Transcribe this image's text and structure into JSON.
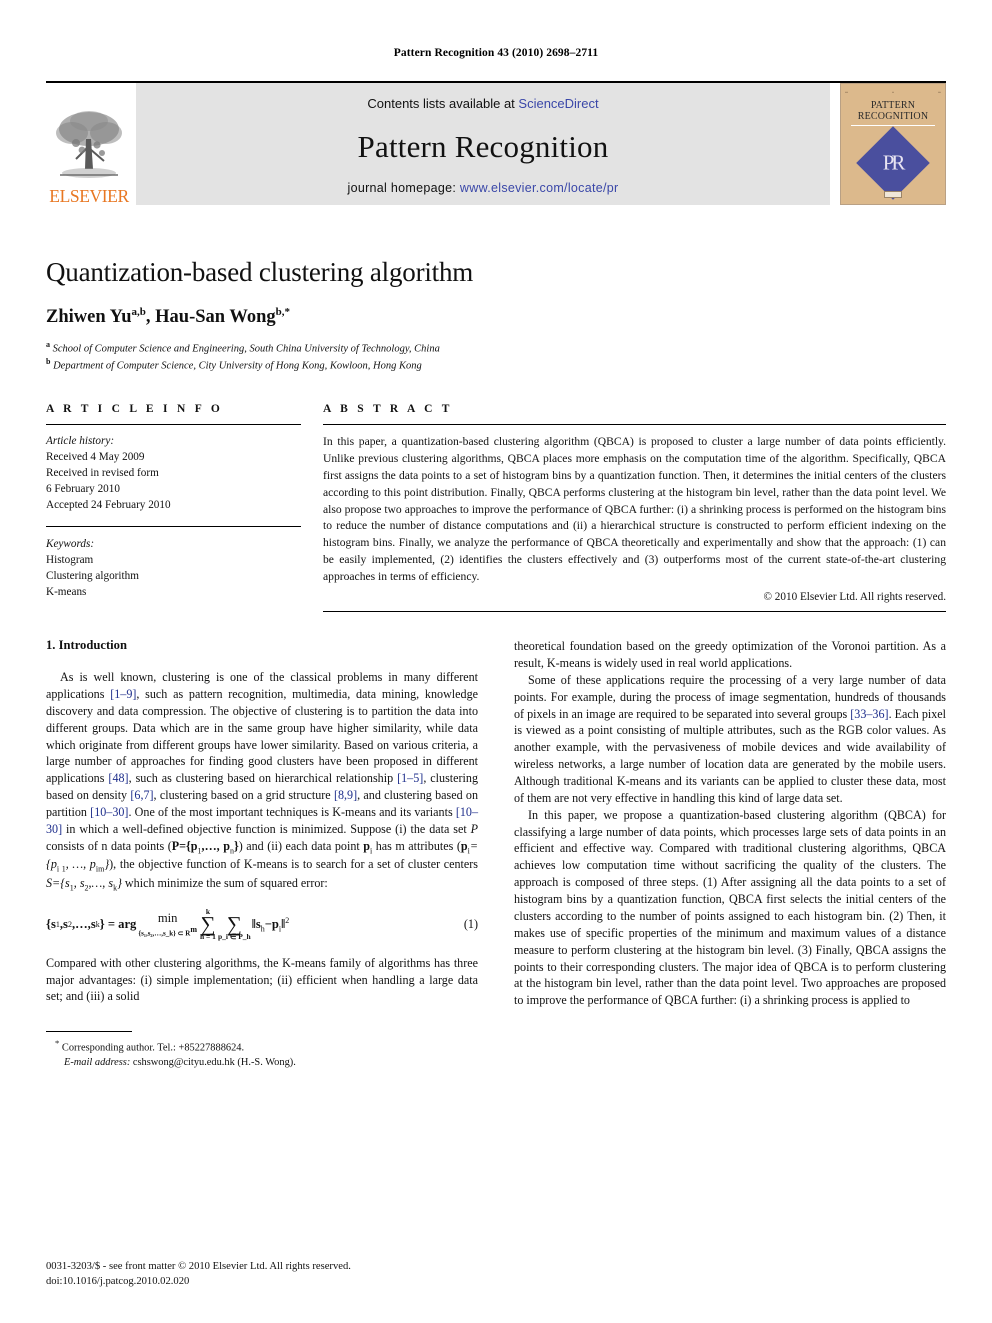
{
  "running_head": "Pattern Recognition 43 (2010) 2698–2711",
  "banner": {
    "publisher_wordmark": "ELSEVIER",
    "contents_prefix": "Contents lists available at ",
    "contents_link": "ScienceDirect",
    "journal_title": "Pattern Recognition",
    "homepage_prefix": "journal homepage: ",
    "homepage_url": "www.elsevier.com/locate/pr",
    "cover": {
      "title_line1": "PATTERN",
      "title_line2": "RECOGNITION",
      "monogram": "PR"
    },
    "link_color": "#3a47a8",
    "elsevier_orange": "#E87722",
    "cover_bg": "#dcb98c",
    "diamond_color": "#4a4f9e"
  },
  "article": {
    "title": "Quantization-based clustering algorithm",
    "authors_part1": "Zhiwen Yu",
    "authors_sup1": "a,b",
    "authors_sep": ", ",
    "authors_part2": "Hau-San Wong",
    "authors_sup2": "b,*",
    "affiliation_a_marker": "a",
    "affiliation_a": "School of Computer Science and Engineering, South China University of Technology, China",
    "affiliation_b_marker": "b",
    "affiliation_b": "Department of Computer Science, City University of Hong Kong, Kowloon, Hong Kong"
  },
  "article_info": {
    "heading": "A R T I C L E  I N F O",
    "history_label": "Article history:",
    "history": [
      "Received 4 May 2009",
      "Received in revised form",
      "6 February 2010",
      "Accepted 24 February 2010"
    ],
    "keywords_label": "Keywords:",
    "keywords": [
      "Histogram",
      "Clustering algorithm",
      "K-means"
    ]
  },
  "abstract": {
    "heading": "A B S T R A C T",
    "text": "In this paper, a quantization-based clustering algorithm (QBCA) is proposed to cluster a large number of data points efficiently. Unlike previous clustering algorithms, QBCA places more emphasis on the computation time of the algorithm. Specifically, QBCA first assigns the data points to a set of histogram bins by a quantization function. Then, it determines the initial centers of the clusters according to this point distribution. Finally, QBCA performs clustering at the histogram bin level, rather than the data point level. We also propose two approaches to improve the performance of QBCA further: (i) a shrinking process is performed on the histogram bins to reduce the number of distance computations and (ii) a hierarchical structure is constructed to perform efficient indexing on the histogram bins. Finally, we analyze the performance of QBCA theoretically and experimentally and show that the approach: (1) can be easily implemented, (2) identifies the clusters effectively and (3) outperforms most of the current state-of-the-art clustering approaches in terms of efficiency.",
    "copyright": "© 2010 Elsevier Ltd. All rights reserved."
  },
  "section": {
    "number_title": "1.  Introduction"
  },
  "left_column": {
    "para1_a": "As is well known, clustering is one of the classical problems in many different applications ",
    "para1_cite1": "[1–9]",
    "para1_b": ", such as pattern recognition, multimedia, data mining, knowledge discovery and data compression. The objective of clustering is to partition the data into different groups. Data which are in the same group have higher similarity, while data which originate from different groups have lower similarity. Based on various criteria, a large number of approaches for finding good clusters have been proposed in different applications ",
    "para1_cite2": "[48]",
    "para1_c": ", such as clustering based on hierarchical relationship ",
    "para1_cite3": "[1–5]",
    "para1_d": ", clustering based on density ",
    "para1_cite4": "[6,7]",
    "para1_e": ", clustering based on a grid structure ",
    "para1_cite5": "[8,9]",
    "para1_f": ", and clustering based on partition ",
    "para1_cite6": "[10–30]",
    "para1_g": ". One of the most important techniques is K-means and its variants ",
    "para1_cite7": "[10–30]",
    "para1_h": " in which a well-defined objective function is minimized. Suppose (i) the data set ",
    "para1_var_P": "P",
    "para1_i": " consists of n data points (",
    "para1_setP": "P={p",
    "para1_setP_sub1": "1",
    "para1_setP_mid": ",…, p",
    "para1_setP_sub2": "n",
    "para1_setP_end": "}",
    "para1_j": ") and (ii) each data point ",
    "para1_pi": "p",
    "para1_pi_sub": "i",
    "para1_k": " has m attributes (",
    "para1_pi2": "p",
    "para1_pi2_sub": "i",
    "para1_pi2_mid": "={p",
    "para1_pi2_sub2": "i 1",
    "para1_pi2_mid2": ", …, p",
    "para1_pi2_sub3": "im",
    "para1_pi2_end": "}",
    "para1_l": "), the objective function of K-means is to search for a set of cluster centers ",
    "para1_S": "S={s",
    "para1_S_sub1": "1",
    "para1_S_mid": ", s",
    "para1_S_sub2": "2",
    "para1_S_mid2": ",…, s",
    "para1_S_sub3": "k",
    "para1_S_end": "}",
    "para1_m": " which minimize the sum of squared error:",
    "equation": {
      "lhs": "{s",
      "lhs_sub1": "1",
      "lhs_m1": ",s",
      "lhs_sub2": "2",
      "lhs_m2": ",…,s",
      "lhs_sub3": "k",
      "lhs_end": "} = arg",
      "min_label": "min",
      "min_constraint": "{s₁,s₂,…,s_k} ⊂ R",
      "min_constraint_sup": "m",
      "sum1_upper": "k",
      "sum1_lower": "h = 1",
      "sum2_lower": "p_i ∈ P_h",
      "sum_glyph": "∑",
      "term": "‖s",
      "term_sub1": "h",
      "term_mid": "−p",
      "term_sub2": "i",
      "term_end": "‖",
      "term_sup": "2",
      "number": "(1)"
    },
    "para2": "Compared with other clustering algorithms, the K-means family of algorithms has three major advantages: (i) simple implementation; (ii) efficient when handling a large data set; and (iii) a solid",
    "footnote_marker": "*",
    "footnote_corresponding": " Corresponding author. Tel.: +85227888624.",
    "footnote_email_label": "E-mail address:",
    "footnote_email": " cshswong@cityu.edu.hk (H.-S. Wong)."
  },
  "right_column": {
    "para_cont": "theoretical foundation based on the greedy optimization of the Voronoi partition. As a result, K-means is widely used in real world applications.",
    "para2_a": "Some of these applications require the processing of a very large number of data points. For example, during the process of image segmentation, hundreds of thousands of pixels in an image are required to be separated into several groups ",
    "para2_cite": "[33–36]",
    "para2_b": ". Each pixel is viewed as a point consisting of multiple attributes, such as the RGB color values. As another example, with the pervasiveness of mobile devices and wide availability of wireless networks, a large number of location data are generated by the mobile users. Although traditional K-means and its variants can be applied to cluster these data, most of them are not very effective in handling this kind of large data set.",
    "para3": "In this paper, we propose a quantization-based clustering algorithm (QBCA) for classifying a large number of data points, which processes large sets of data points in an efficient and effective way. Compared with traditional clustering algorithms, QBCA achieves low computation time without sacrificing the quality of the clusters. The approach is composed of three steps. (1) After assigning all the data points to a set of histogram bins by a quantization function, QBCA first selects the initial centers of the clusters according to the number of points assigned to each histogram bin. (2) Then, it makes use of specific properties of the minimum and maximum values of a distance measure to perform clustering at the histogram bin level. (3) Finally, QBCA assigns the points to their corresponding clusters. The major idea of QBCA is to perform clustering at the histogram bin level, rather than the data point level. Two approaches are proposed to improve the performance of QBCA further: (i) a shrinking process is applied to"
  },
  "footer": {
    "issn_line": "0031-3203/$ - see front matter © 2010 Elsevier Ltd. All rights reserved.",
    "doi_line": "doi:10.1016/j.patcog.2010.02.020"
  }
}
